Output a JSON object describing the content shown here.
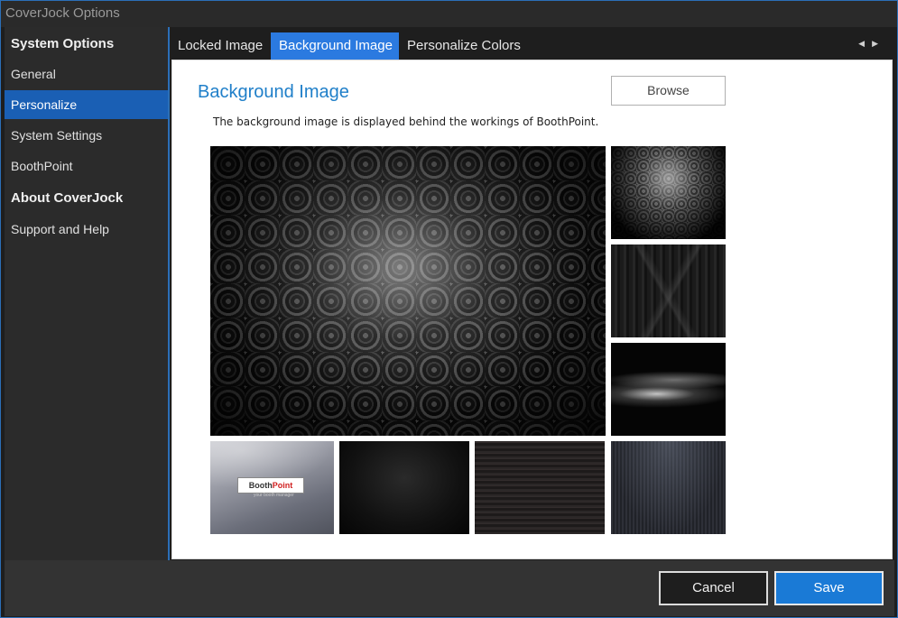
{
  "window": {
    "title": "CoverJock Options"
  },
  "sidebar": {
    "items": [
      {
        "label": "System Options",
        "type": "header"
      },
      {
        "label": "General"
      },
      {
        "label": "Personalize",
        "active": true
      },
      {
        "label": "System Settings"
      },
      {
        "label": "BoothPoint"
      },
      {
        "label": "About CoverJock",
        "type": "header"
      },
      {
        "label": "Support and Help"
      }
    ]
  },
  "tabs": [
    {
      "label": "Locked Image"
    },
    {
      "label": "Background Image",
      "active": true
    },
    {
      "label": "Personalize Colors"
    }
  ],
  "tab_scroll": {
    "left_icon": "scroll-left-icon",
    "right_icon": "scroll-right-icon"
  },
  "panel": {
    "title": "Background Image",
    "browse_label": "Browse",
    "description": "The background image is displayed behind the workings of BoothPoint."
  },
  "thumbnails": {
    "boothpoint_logo": {
      "brand_left": "Booth",
      "brand_right": "Point",
      "tagline": "your booth manager"
    }
  },
  "footer": {
    "cancel_label": "Cancel",
    "save_label": "Save"
  },
  "colors": {
    "accent": "#2b7ae0",
    "sidebar_active": "#1a5fb4",
    "title_blue": "#1f7fc9"
  }
}
